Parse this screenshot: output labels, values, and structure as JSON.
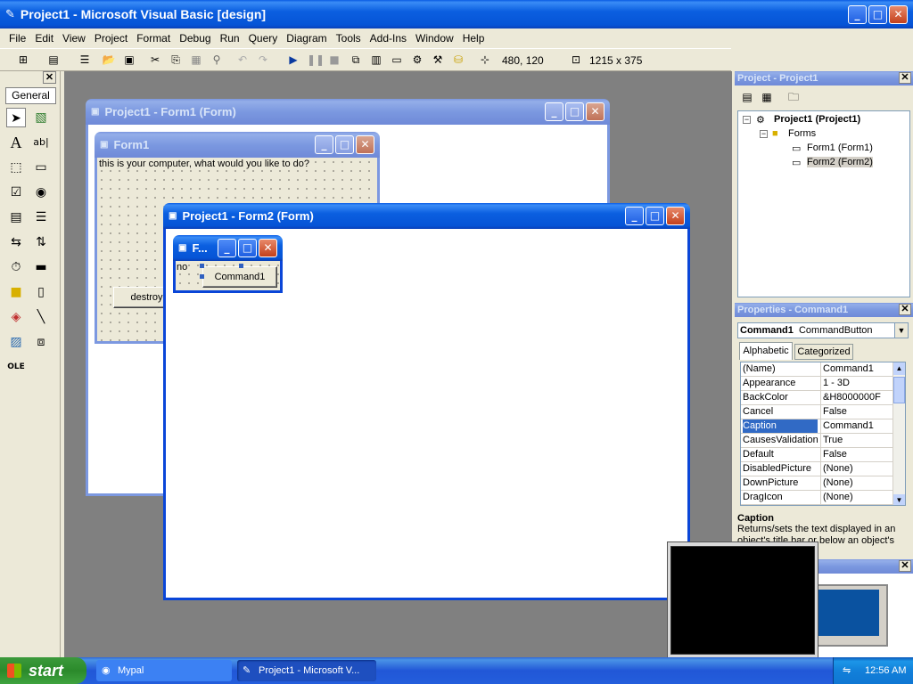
{
  "window": {
    "title": "Project1 - Microsoft Visual Basic [design]"
  },
  "menu": [
    "File",
    "Edit",
    "View",
    "Project",
    "Format",
    "Debug",
    "Run",
    "Query",
    "Diagram",
    "Tools",
    "Add-Ins",
    "Window",
    "Help"
  ],
  "toolbar": {
    "position": "480, 120",
    "size": "1215 x 375"
  },
  "toolbox": {
    "tab_label": "General"
  },
  "form1_designer": {
    "title": "Project1 - Form1 (Form)",
    "form_title": "Form1",
    "label_text": "this is your computer, what would you like to do?",
    "button_text": "destroy"
  },
  "form2_designer": {
    "title": "Project1 - Form2 (Form)",
    "form_title": "F...",
    "label_text": "no",
    "button_text": "Command1"
  },
  "project_explorer": {
    "title": "Project - Project1",
    "root": "Project1 (Project1)",
    "folder": "Forms",
    "items": [
      "Form1 (Form1)",
      "Form2 (Form2)"
    ]
  },
  "properties": {
    "title": "Properties - Command1",
    "object_name": "Command1",
    "object_type": "CommandButton",
    "tabs": [
      "Alphabetic",
      "Categorized"
    ],
    "rows": [
      {
        "name": "(Name)",
        "value": "Command1"
      },
      {
        "name": "Appearance",
        "value": "1 - 3D"
      },
      {
        "name": "BackColor",
        "value": "&H8000000F"
      },
      {
        "name": "Cancel",
        "value": "False"
      },
      {
        "name": "Caption",
        "value": "Command1"
      },
      {
        "name": "CausesValidation",
        "value": "True"
      },
      {
        "name": "Default",
        "value": "False"
      },
      {
        "name": "DisabledPicture",
        "value": "(None)"
      },
      {
        "name": "DownPicture",
        "value": "(None)"
      },
      {
        "name": "DragIcon",
        "value": "(None)"
      }
    ],
    "selected_index": 4,
    "desc_title": "Caption",
    "desc_text": "Returns/sets the text displayed in an object's title bar or below an object's"
  },
  "taskbar": {
    "start_label": "start",
    "tasks": [
      "Mypal",
      "Project1 - Microsoft V..."
    ],
    "clock": "12:56 AM"
  }
}
